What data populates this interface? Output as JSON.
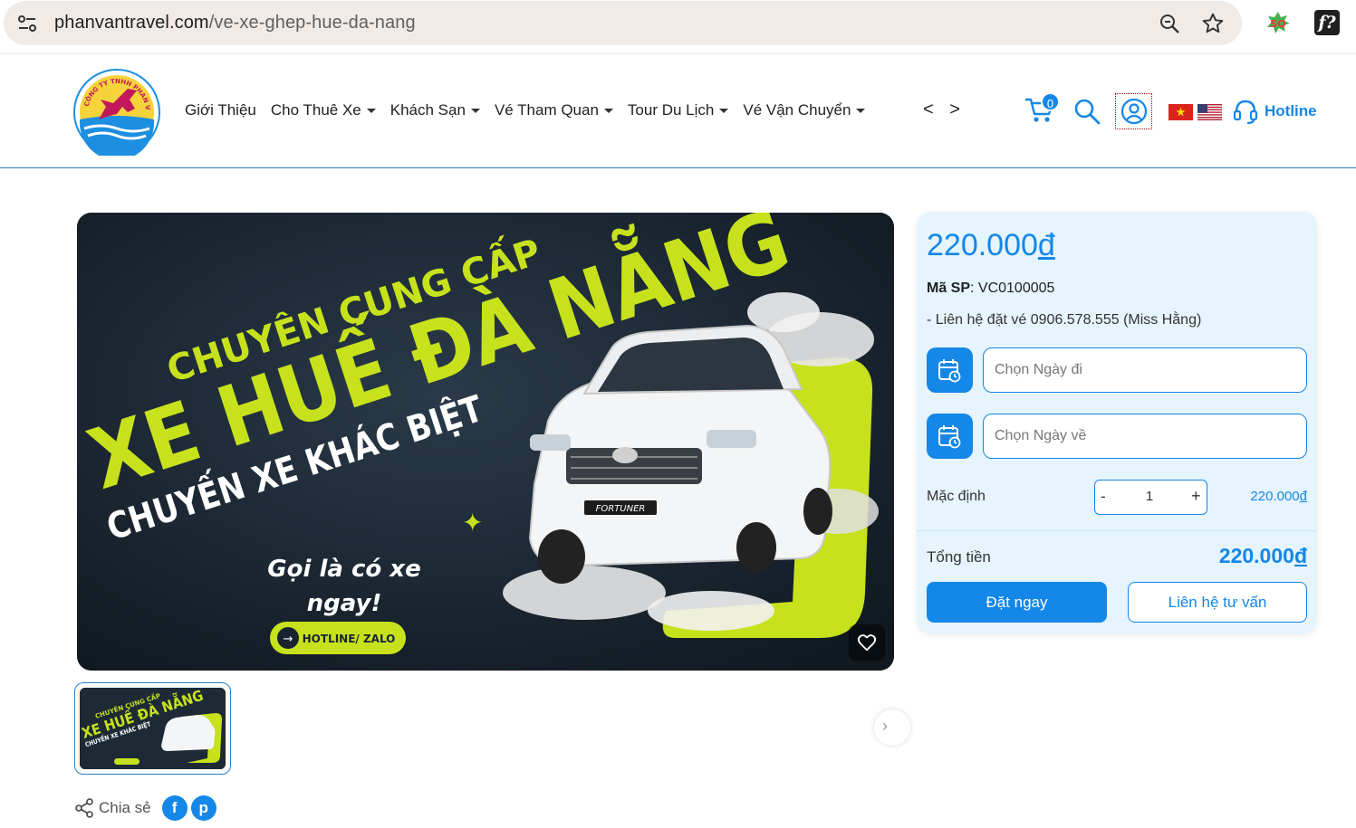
{
  "browser": {
    "url_host": "phanvantravel.com",
    "url_path": "/ve-xe-ghep-hue-da-nang"
  },
  "header": {
    "nav": [
      "Giới Thiệu",
      "Cho Thuê Xe",
      "Khách Sạn",
      "Vé Tham Quan",
      "Tour Du Lịch",
      "Vé Vận Chuyển"
    ],
    "nav_arrows": "< >",
    "cart_count": "0",
    "hotline_label": "Hotline",
    "logo_text": "CÔNG TY TNHH PHAN VĂN"
  },
  "banner": {
    "line1": "CHUYÊN CUNG CẤP",
    "line2": "XE HUẾ ĐÀ NẴNG",
    "line3": "CHUYẾN XE KHÁC BIỆT",
    "cta": "Gọi là có xe",
    "cta2": "ngay!",
    "hotline_btn": "HOTLINE/ ZALO",
    "car_plate": "FORTUNER"
  },
  "share": {
    "label": "Chia sẻ",
    "facebook": "f",
    "pinterest": "p"
  },
  "panel": {
    "price": "220.000",
    "currency": "đ",
    "sku_label": "Mã SP",
    "sku_value": ": VC0100005",
    "contact": "- Liên hệ đặt vé 0906.578.555 (Miss Hằng)",
    "depart_placeholder": "Chọn Ngày đi",
    "return_placeholder": "Chọn Ngày về",
    "default_label": "Mặc định",
    "minus": "-",
    "quantity": "1",
    "plus": "+",
    "line_price": "220.000",
    "total_label": "Tổng tiền",
    "total_value": "220.000",
    "book_label": "Đặt ngay",
    "consult_label": "Liên hệ tư vấn"
  },
  "colors": {
    "accent": "#1487e8",
    "banner_green": "#c7e21c",
    "banner_dark": "#18232f",
    "panel_bg": "#e5f4fd"
  }
}
